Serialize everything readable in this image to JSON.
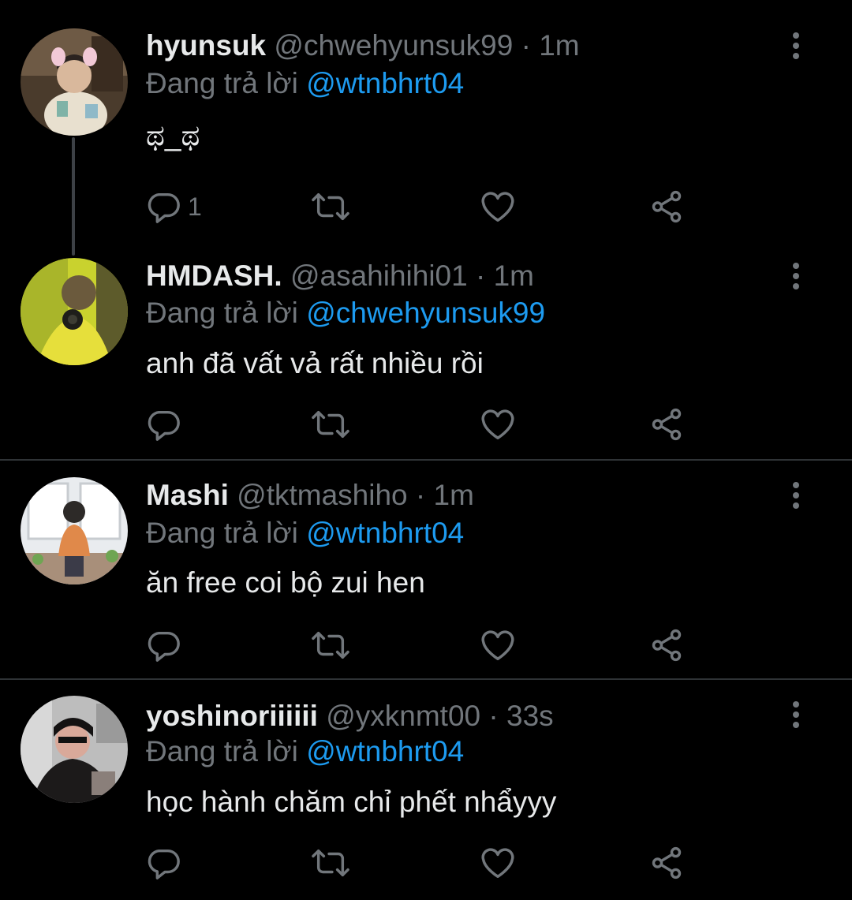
{
  "tweets": [
    {
      "display_name": "hyunsuk",
      "handle": "@chwehyunsuk99",
      "separator": "·",
      "time": "1m",
      "reply_prefix": "Đang trả lời",
      "reply_to": "@wtnbhrt04",
      "text": "ಥ_ಥ",
      "reply_count": "1"
    },
    {
      "display_name": "HMDASH.",
      "handle": "@asahihihi01",
      "separator": "·",
      "time": "1m",
      "reply_prefix": "Đang trả lời",
      "reply_to": "@chwehyunsuk99",
      "text": "anh đã vất vả rất nhiều rồi",
      "reply_count": ""
    },
    {
      "display_name": "Mashi",
      "handle": "@tktmashiho",
      "separator": "·",
      "time": "1m",
      "reply_prefix": "Đang trả lời",
      "reply_to": "@wtnbhrt04",
      "text": "ăn free coi bộ zui hen",
      "reply_count": ""
    },
    {
      "display_name": "yoshinoriiiiii",
      "handle": "@yxknmt00",
      "separator": "·",
      "time": "33s",
      "reply_prefix": "Đang trả lời",
      "reply_to": "@wtnbhrt04",
      "text": "học hành chăm chỉ phết nhẩyyy",
      "reply_count": ""
    }
  ],
  "icons": {
    "reply": "reply-icon",
    "retweet": "retweet-icon",
    "like": "heart-icon",
    "share": "share-icon",
    "more": "more-options-icon"
  },
  "colors": {
    "background": "#000000",
    "primary_text": "#e7e9ea",
    "secondary_text": "#71767b",
    "link": "#1d9bf0",
    "divider": "#2f3336"
  }
}
